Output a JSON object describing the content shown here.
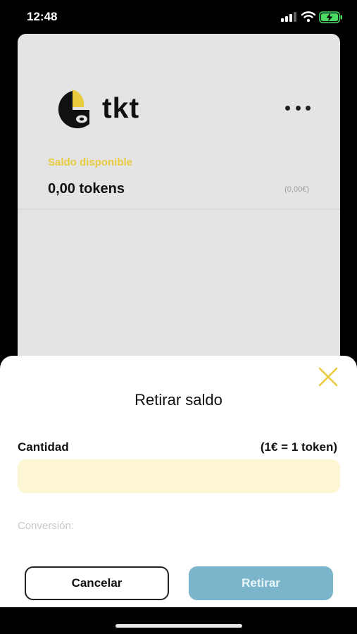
{
  "status_bar": {
    "time": "12:48"
  },
  "wallet": {
    "brand": "tkt",
    "balance_label": "Saldo disponible",
    "balance_tokens": "0,00 tokens",
    "balance_euros": "(0,00€)"
  },
  "sheet": {
    "title": "Retirar saldo",
    "amount_label": "Cantidad",
    "rate_label": "(1€ = 1 token)",
    "amount_value": "",
    "conversion_label": "Conversión:",
    "cancel_label": "Cancelar",
    "withdraw_label": "Retirar"
  },
  "colors": {
    "accent_yellow": "#e9cb3e",
    "input_bg": "#fdf6d2",
    "withdraw_button": "#7ab5cc",
    "battery_green": "#4cd964"
  },
  "icons": [
    "signal-icon",
    "wifi-icon",
    "battery-charging-icon",
    "tkt-logo",
    "more-icon",
    "close-icon"
  ]
}
